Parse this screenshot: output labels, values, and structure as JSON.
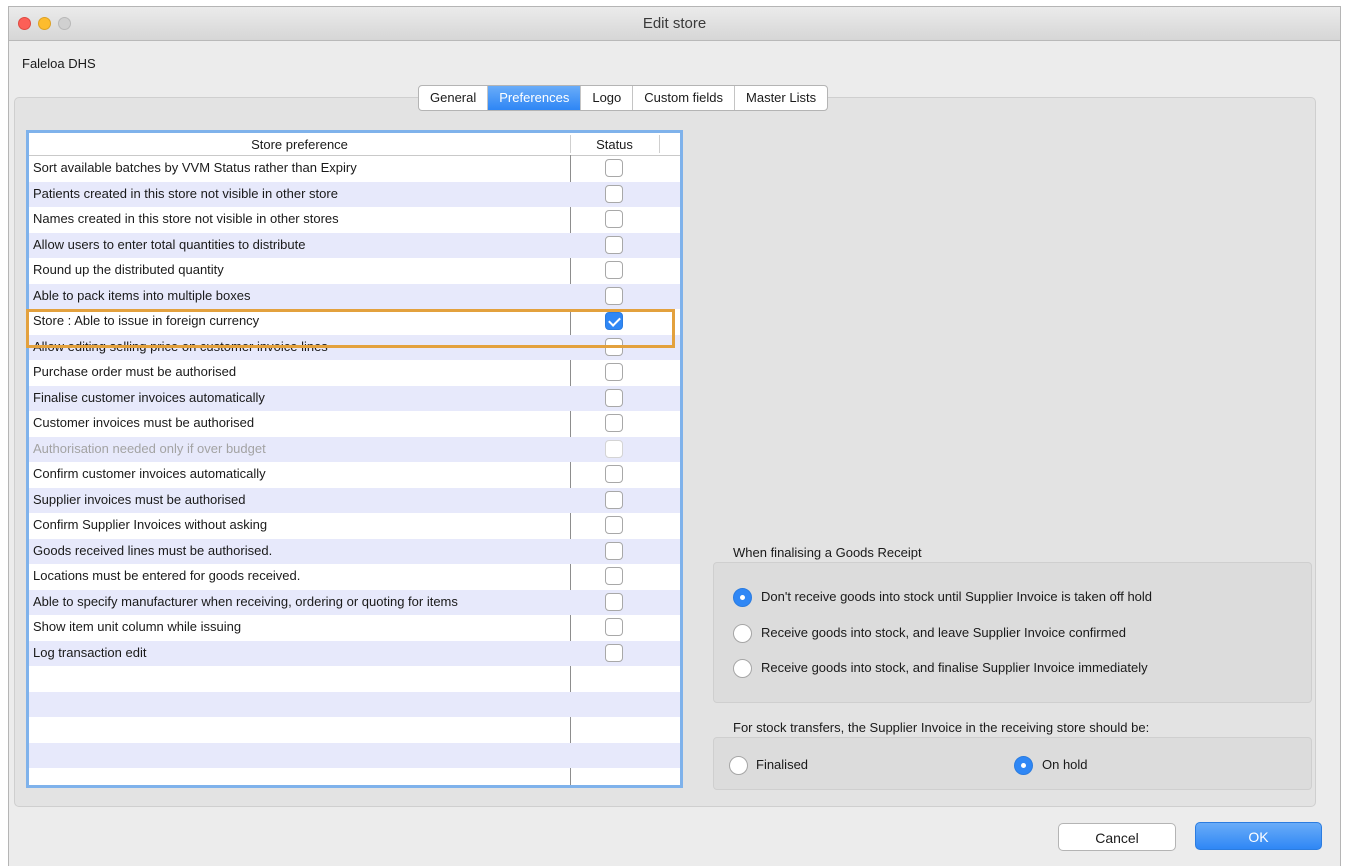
{
  "window": {
    "title": "Edit store"
  },
  "store_name": "Faleloa DHS",
  "tabs": [
    {
      "label": "General",
      "active": false
    },
    {
      "label": "Preferences",
      "active": true
    },
    {
      "label": "Logo",
      "active": false
    },
    {
      "label": "Custom fields",
      "active": false
    },
    {
      "label": "Master Lists",
      "active": false
    }
  ],
  "table": {
    "headers": {
      "preference": "Store preference",
      "status": "Status"
    },
    "rows": [
      {
        "label": "Sort available batches by VVM Status rather than Expiry",
        "checked": false,
        "disabled": false
      },
      {
        "label": "Patients created in this store not visible in other store",
        "checked": false,
        "disabled": false
      },
      {
        "label": "Names created in this store not visible in other stores",
        "checked": false,
        "disabled": false
      },
      {
        "label": "Allow users to enter total quantities to distribute",
        "checked": false,
        "disabled": false
      },
      {
        "label": "Round up the distributed quantity",
        "checked": false,
        "disabled": false
      },
      {
        "label": "Able to pack items into multiple boxes",
        "checked": false,
        "disabled": false
      },
      {
        "label": "Store : Able to issue in foreign currency",
        "checked": true,
        "disabled": false
      },
      {
        "label": "Allow editing selling price on customer invoice lines",
        "checked": false,
        "disabled": false
      },
      {
        "label": "Purchase order must be authorised",
        "checked": false,
        "disabled": false
      },
      {
        "label": "Finalise customer invoices automatically",
        "checked": false,
        "disabled": false
      },
      {
        "label": "Customer invoices must be authorised",
        "checked": false,
        "disabled": false
      },
      {
        "label": "Authorisation needed only if over budget",
        "checked": false,
        "disabled": true
      },
      {
        "label": "Confirm customer invoices automatically",
        "checked": false,
        "disabled": false
      },
      {
        "label": "Supplier invoices must be authorised",
        "checked": false,
        "disabled": false
      },
      {
        "label": "Confirm Supplier Invoices without asking",
        "checked": false,
        "disabled": false
      },
      {
        "label": "Goods received lines must be authorised.",
        "checked": false,
        "disabled": false
      },
      {
        "label": "Locations must be entered for goods received.",
        "checked": false,
        "disabled": false
      },
      {
        "label": "Able to specify manufacturer when receiving, ordering or quoting for items",
        "checked": false,
        "disabled": false
      },
      {
        "label": "Show item unit column while issuing",
        "checked": false,
        "disabled": false
      },
      {
        "label": "Log transaction edit",
        "checked": false,
        "disabled": false
      }
    ],
    "empty_rows": 5
  },
  "goods_receipt": {
    "label": "When finalising a Goods Receipt",
    "options": [
      {
        "label": "Don't receive goods into stock until Supplier Invoice is taken off hold",
        "selected": true
      },
      {
        "label": "Receive goods into stock, and leave Supplier Invoice confirmed",
        "selected": false
      },
      {
        "label": "Receive goods into stock, and finalise Supplier Invoice immediately",
        "selected": false
      }
    ]
  },
  "stock_transfers": {
    "label": "For stock transfers, the Supplier Invoice in the receiving store should be:",
    "options": [
      {
        "label": "Finalised",
        "selected": false
      },
      {
        "label": "On hold",
        "selected": true
      }
    ]
  },
  "buttons": {
    "cancel": "Cancel",
    "ok": "OK"
  }
}
